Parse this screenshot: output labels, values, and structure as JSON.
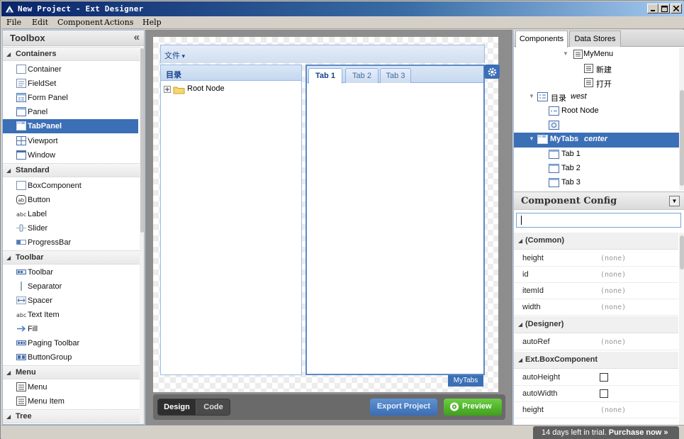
{
  "window": {
    "title": "New Project - Ext Designer"
  },
  "menubar": [
    "File",
    "Edit",
    "Component",
    "Actions",
    "Help"
  ],
  "toolbox": {
    "title": "Toolbox",
    "groups": [
      {
        "label": "Containers",
        "items": [
          "Container",
          "FieldSet",
          "Form Panel",
          "Panel",
          "TabPanel",
          "Viewport",
          "Window"
        ]
      },
      {
        "label": "Standard",
        "items": [
          "BoxComponent",
          "Button",
          "Label",
          "Slider",
          "ProgressBar"
        ]
      },
      {
        "label": "Toolbar",
        "items": [
          "Toolbar",
          "Separator",
          "Spacer",
          "Text Item",
          "Fill",
          "Paging Toolbar",
          "ButtonGroup"
        ]
      },
      {
        "label": "Menu",
        "items": [
          "Menu",
          "Menu Item"
        ]
      },
      {
        "label": "Tree",
        "items": []
      }
    ],
    "selected_item": "TabPanel"
  },
  "canvas": {
    "menu_label": "文件",
    "west_title": "目录",
    "root_node": "Root Node",
    "tabs": [
      "Tab 1",
      "Tab 2",
      "Tab 3"
    ],
    "active_tab": "Tab 1",
    "component_tag": "MyTabs",
    "mode_design": "Design",
    "mode_code": "Code",
    "export_label": "Export Project",
    "preview_label": "Preview"
  },
  "right": {
    "tabs": [
      "Components",
      "Data Stores"
    ],
    "tree": {
      "mymenu": "MyMenu",
      "new_item": "新建",
      "open_item": "打开",
      "west_name": "目录",
      "west_region": "west",
      "root_node": "Root Node",
      "mytabs": "MyTabs",
      "mytabs_region": "center",
      "tab1": "Tab 1",
      "tab2": "Tab 2",
      "tab3": "Tab 3"
    },
    "config_title": "Component Config",
    "search_value": "",
    "groups": {
      "common": "(Common)",
      "designer": "(Designer)",
      "box": "Ext.BoxComponent"
    },
    "props": {
      "height": "height",
      "id": "id",
      "itemId": "itemId",
      "width": "width",
      "autoRef": "autoRef",
      "autoHeight": "autoHeight",
      "autoWidth": "autoWidth",
      "height2": "height",
      "none": "(none)"
    }
  },
  "status": {
    "trial_text": "14 days left in trial.",
    "purchase": "Purchase now »"
  },
  "colors": {
    "selection": "#3b6fb6",
    "preview": "#4fb22a",
    "export": "#4a7cc1"
  }
}
